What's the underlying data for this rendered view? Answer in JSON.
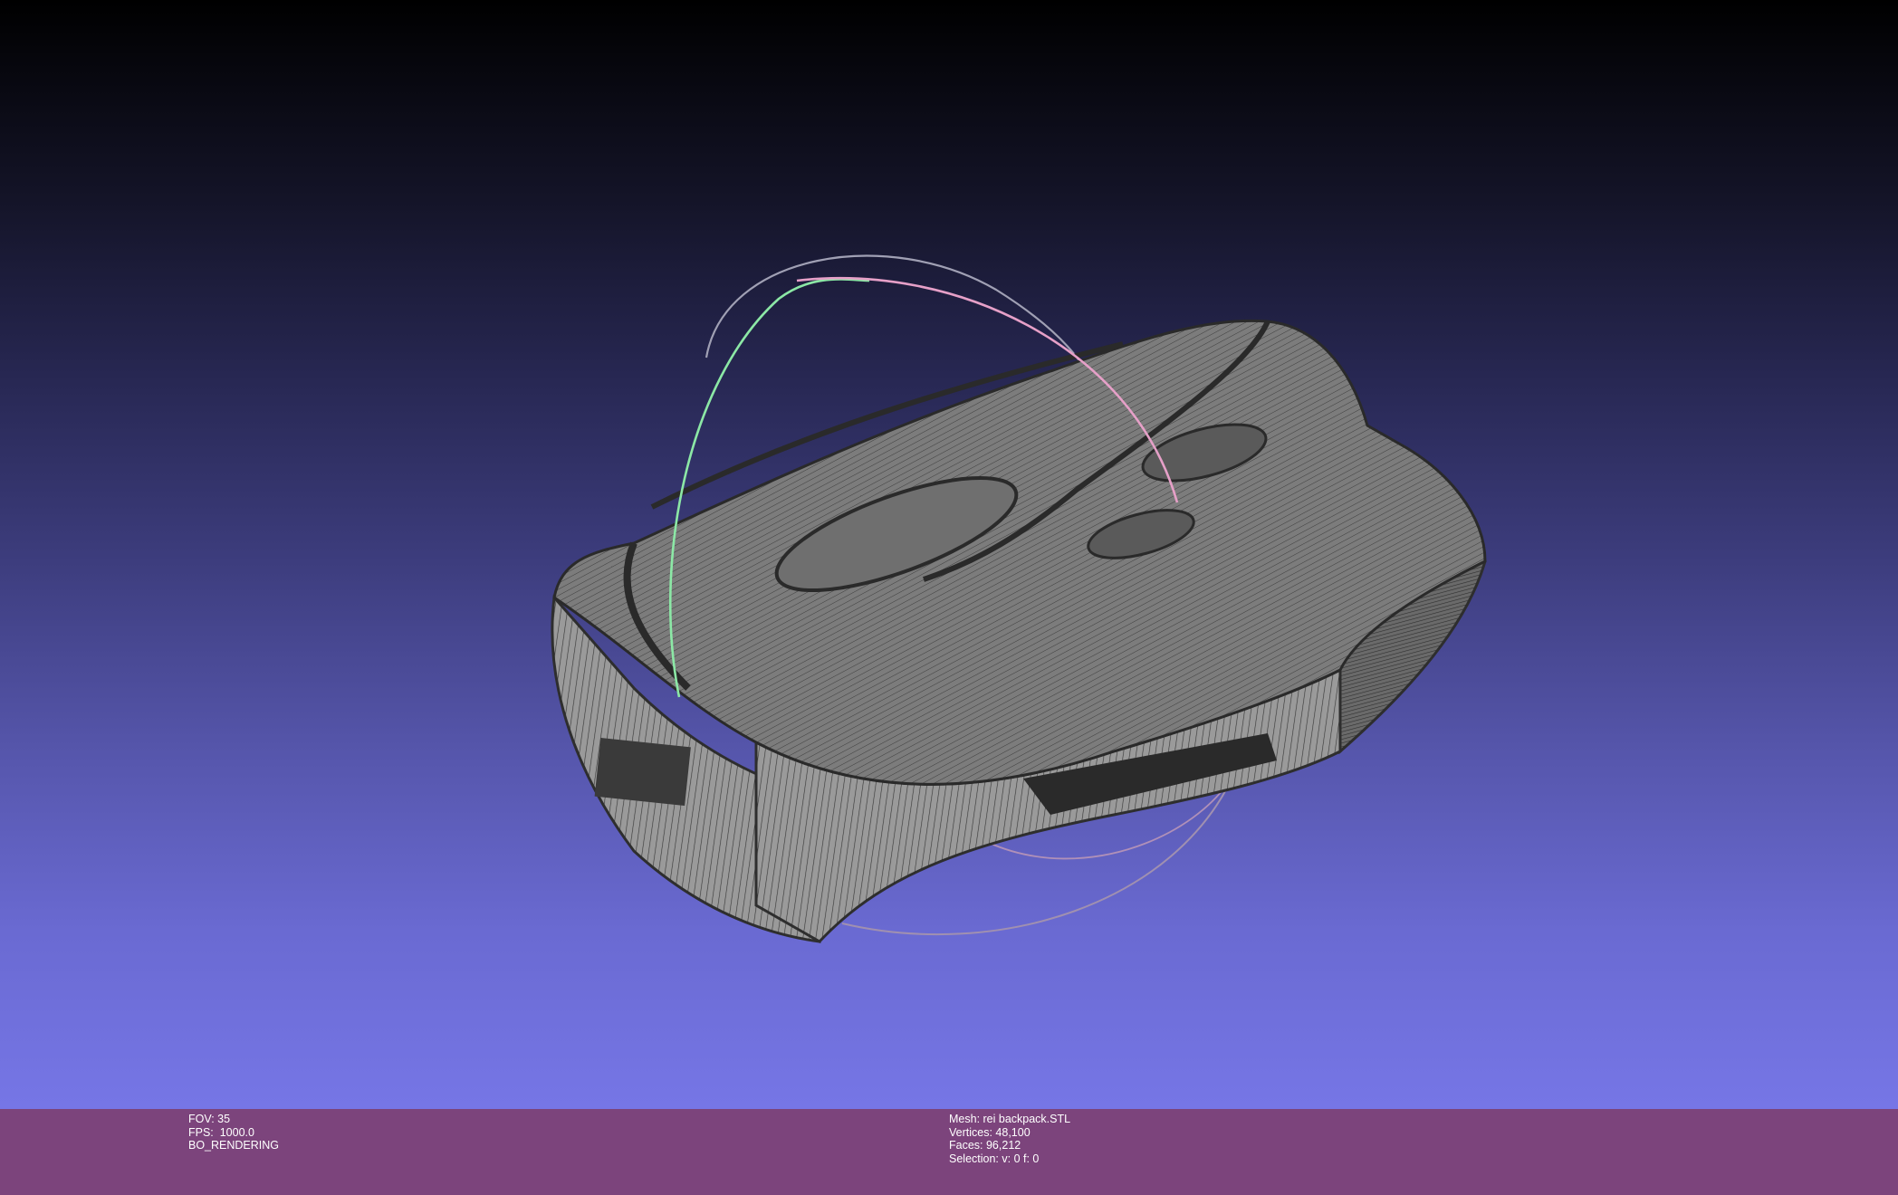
{
  "viewport": {
    "background_top": "#000000",
    "background_bottom": "#7676e6",
    "mesh_fill": "#7a7a7a",
    "wire_color": "#3a3a3a",
    "trackball_colors": {
      "x_ring": "#e6a0c8",
      "y_ring": "#8ce8a6",
      "z_ring": "#a0a0b4"
    }
  },
  "status_bar": {
    "background": "#7c447c",
    "render_info": {
      "fov": "FOV: 35",
      "fps": "FPS:  1000.0",
      "mode": "BO_RENDERING"
    },
    "mesh_info": {
      "mesh": "Mesh: rei backpack.STL",
      "vertices": "Vertices: 48,100",
      "faces": "Faces: 96,212",
      "selection": "Selection: v: 0 f: 0"
    }
  }
}
